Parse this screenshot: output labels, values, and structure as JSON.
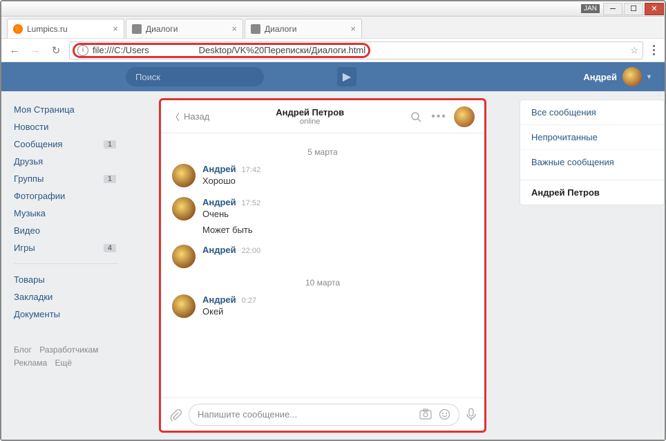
{
  "titlebar": {
    "lang": "JAN"
  },
  "tabs": [
    {
      "label": "Lumpics.ru",
      "fav": "l"
    },
    {
      "label": "Диалоги",
      "fav": "g"
    },
    {
      "label": "Диалоги",
      "fav": "g"
    }
  ],
  "url": {
    "prefix": "file:///C:/Users",
    "suffix": "Desktop/VK%20Переписки/Диалоги.html"
  },
  "header": {
    "search_placeholder": "Поиск",
    "username": "Андрей"
  },
  "leftnav": {
    "items": [
      {
        "label": "Моя Страница"
      },
      {
        "label": "Новости"
      },
      {
        "label": "Сообщения",
        "badge": "1"
      },
      {
        "label": "Друзья"
      },
      {
        "label": "Группы",
        "badge": "1"
      },
      {
        "label": "Фотографии"
      },
      {
        "label": "Музыка"
      },
      {
        "label": "Видео"
      },
      {
        "label": "Игры",
        "badge": "4"
      }
    ],
    "items2": [
      {
        "label": "Товары"
      },
      {
        "label": "Закладки"
      },
      {
        "label": "Документы"
      }
    ],
    "footer": [
      "Блог",
      "Разработчикам",
      "Реклама",
      "Ещё"
    ]
  },
  "chat": {
    "back": "Назад",
    "title": "Андрей Петров",
    "status": "online",
    "composer_placeholder": "Напишите сообщение...",
    "dates": {
      "d1": "5 марта",
      "d2": "10 марта"
    },
    "messages": [
      {
        "name": "Андрей",
        "time": "17:42",
        "text": "Хорошо"
      },
      {
        "name": "Андрей",
        "time": "17:52",
        "text": "Очень"
      },
      {
        "extra": "Может быть"
      },
      {
        "name": "Андрей",
        "time": "22:00",
        "text": ""
      },
      {
        "name": "Андрей",
        "time": "0:27",
        "text": "Окей"
      }
    ]
  },
  "rightcol": {
    "items": [
      "Все сообщения",
      "Непрочитанные",
      "Важные сообщения"
    ],
    "active": "Андрей Петров"
  }
}
